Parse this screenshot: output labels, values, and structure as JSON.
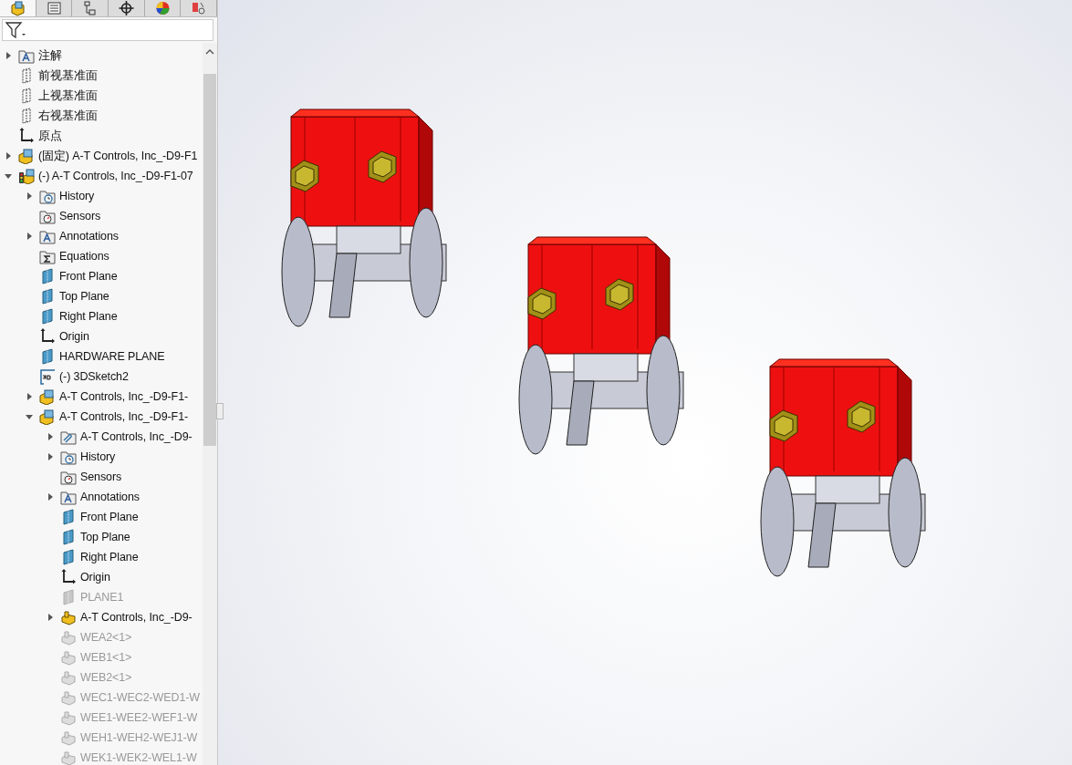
{
  "panel_tabs": [
    {
      "kind": "features",
      "selected": true
    },
    {
      "kind": "properties",
      "selected": false
    },
    {
      "kind": "configurations",
      "selected": false
    },
    {
      "kind": "dimxpert",
      "selected": false
    },
    {
      "kind": "display",
      "selected": false
    },
    {
      "kind": "cam",
      "selected": false
    }
  ],
  "tree": [
    {
      "kind": "annotations",
      "label": "注解",
      "expanded": false,
      "suppressed": false
    },
    {
      "kind": "plane-outline",
      "label": "前视基准面",
      "suppressed": false
    },
    {
      "kind": "plane-outline",
      "label": "上视基准面",
      "suppressed": false
    },
    {
      "kind": "plane-outline",
      "label": "右视基准面",
      "suppressed": false
    },
    {
      "kind": "origin",
      "label": "原点",
      "suppressed": false
    },
    {
      "kind": "assembly",
      "label": "(固定) A-T Controls, Inc_-D9-F1",
      "expanded": false,
      "suppressed": false
    },
    {
      "kind": "assembly-status",
      "label": "(-) A-T Controls, Inc_-D9-F1-07",
      "expanded": true,
      "suppressed": false,
      "children": [
        {
          "kind": "history",
          "label": "History",
          "expanded": false,
          "suppressed": false
        },
        {
          "kind": "sensors",
          "label": "Sensors",
          "suppressed": false
        },
        {
          "kind": "annotations",
          "label": "Annotations",
          "expanded": false,
          "suppressed": false
        },
        {
          "kind": "equations",
          "label": "Equations",
          "suppressed": false
        },
        {
          "kind": "plane",
          "label": "Front Plane",
          "suppressed": false
        },
        {
          "kind": "plane",
          "label": "Top Plane",
          "suppressed": false
        },
        {
          "kind": "plane",
          "label": "Right Plane",
          "suppressed": false
        },
        {
          "kind": "origin",
          "label": "Origin",
          "suppressed": false
        },
        {
          "kind": "plane",
          "label": "HARDWARE PLANE",
          "suppressed": false
        },
        {
          "kind": "sketch3d",
          "label": "(-) 3DSketch2",
          "suppressed": false
        },
        {
          "kind": "assembly",
          "label": "A-T Controls, Inc_-D9-F1-",
          "expanded": false,
          "suppressed": false
        },
        {
          "kind": "assembly",
          "label": "A-T Controls, Inc_-D9-F1-",
          "expanded": true,
          "suppressed": false,
          "children": [
            {
              "kind": "link",
              "label": "A-T Controls, Inc_-D9-",
              "expanded": false,
              "suppressed": false
            },
            {
              "kind": "history",
              "label": "History",
              "expanded": false,
              "suppressed": false
            },
            {
              "kind": "sensors",
              "label": "Sensors",
              "suppressed": false
            },
            {
              "kind": "annotations",
              "label": "Annotations",
              "expanded": false,
              "suppressed": false
            },
            {
              "kind": "plane",
              "label": "Front Plane",
              "suppressed": false
            },
            {
              "kind": "plane",
              "label": "Top Plane",
              "suppressed": false
            },
            {
              "kind": "plane",
              "label": "Right Plane",
              "suppressed": false
            },
            {
              "kind": "origin",
              "label": "Origin",
              "suppressed": false
            },
            {
              "kind": "plane",
              "label": "PLANE1",
              "suppressed": true
            },
            {
              "kind": "part",
              "label": "A-T Controls, Inc_-D9-",
              "expanded": false,
              "suppressed": false
            },
            {
              "kind": "part",
              "label": "WEA2<1>",
              "suppressed": true
            },
            {
              "kind": "part",
              "label": "WEB1<1>",
              "suppressed": true
            },
            {
              "kind": "part",
              "label": "WEB2<1>",
              "suppressed": true
            },
            {
              "kind": "part",
              "label": "WEC1-WEC2-WED1-W",
              "suppressed": true
            },
            {
              "kind": "part",
              "label": "WEE1-WEE2-WEF1-W",
              "suppressed": true
            },
            {
              "kind": "part",
              "label": "WEH1-WEH2-WEJ1-W",
              "suppressed": true
            },
            {
              "kind": "part",
              "label": "WEK1-WEK2-WEL1-W",
              "suppressed": true
            }
          ]
        }
      ]
    }
  ],
  "models": [
    {
      "kind": "valve"
    },
    {
      "kind": "valve"
    },
    {
      "kind": "valve"
    }
  ]
}
